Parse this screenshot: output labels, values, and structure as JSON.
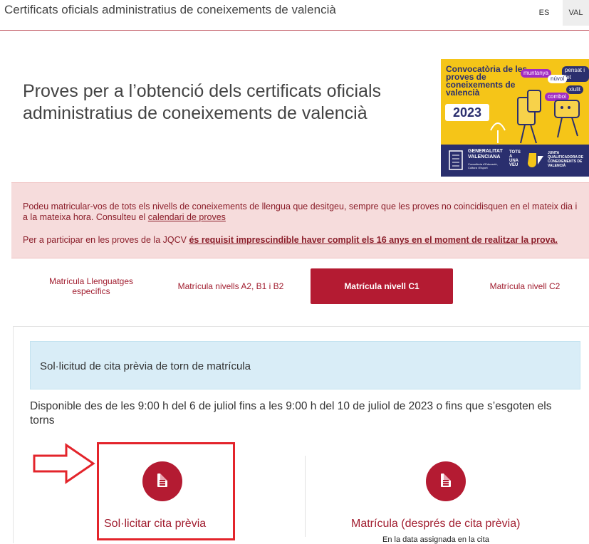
{
  "header": {
    "site_title": "Certificats oficials administratius de coneixements de valencià",
    "languages": [
      "ES",
      "VAL"
    ],
    "active_language": "VAL"
  },
  "hero": {
    "title": "Proves per a l’obtenció dels certificats oficials administratius de coneixements de valencià"
  },
  "banner": {
    "headline": "Convocatòria de les proves de coneixements de valencià",
    "year": "2023",
    "bubbles": [
      "muntanya",
      "pensat i fet",
      "núvol",
      "xiulit",
      "comboi"
    ],
    "org_1": "GENERALITAT VALENCIANA",
    "org_1_sub": "Conselleria d'Educació, Cultura i Esport",
    "org_2": "TOTS A UNA VEU",
    "org_3": "JUNTA QUALIFICADORA DE CONEIXEMENTS DE VALENCIÀ"
  },
  "alert": {
    "line1_text": "Podeu matricular-vos de tots els nivells de coneixements de llengua que desitgeu, sempre que les proves no coincidisquen en el mateix dia i a la mateixa hora. Consulteu el ",
    "line1_link": "calendari de proves",
    "line2_text": "Per a participar en les proves de la JQCV ",
    "line2_link": "és requisit imprescindible haver complit els 16 anys en el moment de realitzar la prova."
  },
  "tabs": [
    {
      "label": "Matrícula Llenguatges específics",
      "active": false
    },
    {
      "label": "Matrícula nivells A2, B1 i B2",
      "active": false
    },
    {
      "label": "Matrícula nivell C1",
      "active": true
    },
    {
      "label": "Matrícula nivell C2",
      "active": false
    }
  ],
  "content": {
    "info_title": "Sol·licitud de cita prèvia de torn de matrícula",
    "availability": "Disponible des de les 9:00 h del 6 de juliol fins a les 9:00 h del 10 de juliol de 2023 o fins que s’esgoten els torns",
    "actions": [
      {
        "label": "Sol·licitar cita prèvia",
        "icon": "document-icon"
      },
      {
        "label": "Matrícula (després de cita prèvia)",
        "icon": "document-icon",
        "note": "En la data assignada en la cita"
      }
    ]
  },
  "colors": {
    "brand_red": "#b41b32",
    "alert_bg": "#f6dcdc",
    "info_bg": "#d9edf7",
    "highlight": "#e3242b",
    "banner_yellow": "#f5c518",
    "banner_navy": "#2a2f6e"
  }
}
